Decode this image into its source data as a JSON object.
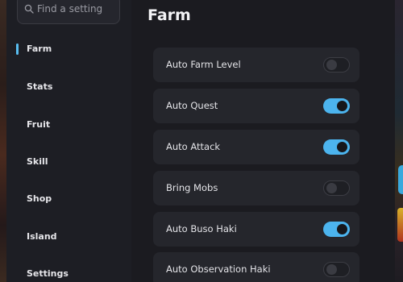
{
  "search": {
    "placeholder": "Find a setting"
  },
  "sidebar": {
    "items": [
      {
        "label": "Farm",
        "active": true
      },
      {
        "label": "Stats",
        "active": false
      },
      {
        "label": "Fruit",
        "active": false
      },
      {
        "label": "Skill",
        "active": false
      },
      {
        "label": "Shop",
        "active": false
      },
      {
        "label": "Island",
        "active": false
      },
      {
        "label": "Settings",
        "active": false
      }
    ]
  },
  "main": {
    "title": "Farm",
    "settings": [
      {
        "label": "Auto Farm Level",
        "enabled": false
      },
      {
        "label": "Auto Quest",
        "enabled": true
      },
      {
        "label": "Auto Attack",
        "enabled": true
      },
      {
        "label": "Bring Mobs",
        "enabled": false
      },
      {
        "label": "Auto Buso Haki",
        "enabled": true
      },
      {
        "label": "Auto Observation Haki",
        "enabled": false
      }
    ]
  },
  "colors": {
    "accent": "#4cb4ee",
    "panel": "#1d1e24",
    "row": "#25262c",
    "background": "#1b1b20"
  }
}
